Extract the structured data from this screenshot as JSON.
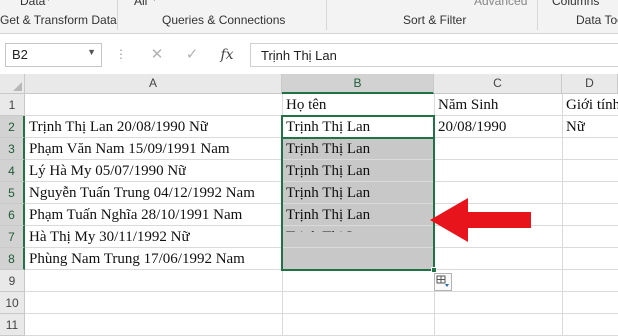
{
  "ribbon": {
    "group_get_transform": "Get & Transform Data",
    "group_queries": "Queries & Connections",
    "group_sort_filter": "Sort & Filter",
    "group_data_tools": "Data Too",
    "cut_data": "Data",
    "cut_all": "All",
    "cut_advanced": "Advanced",
    "cut_columns": "Columns"
  },
  "formula_bar": {
    "name_box": "B2",
    "formula": "Trịnh Thị Lan",
    "fx_label": "fx"
  },
  "columns": [
    "A",
    "B",
    "C",
    "D"
  ],
  "rows": [
    "1",
    "2",
    "3",
    "4",
    "5",
    "6",
    "7",
    "8",
    "9",
    "10",
    "11"
  ],
  "cells": {
    "B1": "Họ tên",
    "C1": "Năm Sinh",
    "D1": "Giới tính",
    "A2": "Trịnh Thị Lan 20/08/1990 Nữ",
    "A3": "Phạm Văn Nam 15/09/1991 Nam",
    "A4": "Lý Hà My 05/07/1990 Nữ",
    "A5": "Nguyễn Tuấn Trung 04/12/1992 Nam",
    "A6": "Phạm Tuấn Nghĩa 28/10/1991 Nam",
    "A7": "Hà Thị My 30/11/1992 Nữ",
    "A8": "Phùng Nam Trung 17/06/1992 Nam",
    "B2": "Trịnh Thị Lan",
    "B3": "Trịnh Thị Lan",
    "B4": "Trịnh Thị Lan",
    "B5": "Trịnh Thị Lan",
    "B6": "Trịnh Thị Lan",
    "B7": "Trịnh Thị Lan",
    "C2": "20/08/1990",
    "D2": "Nữ"
  },
  "colors": {
    "selection_border": "#217346",
    "selection_fill": "#c8c8c8",
    "annotation_arrow": "#e8141b"
  },
  "icons": {
    "flash_fill": "flash-fill-options-icon",
    "arrow": "red-arrow-icon"
  }
}
